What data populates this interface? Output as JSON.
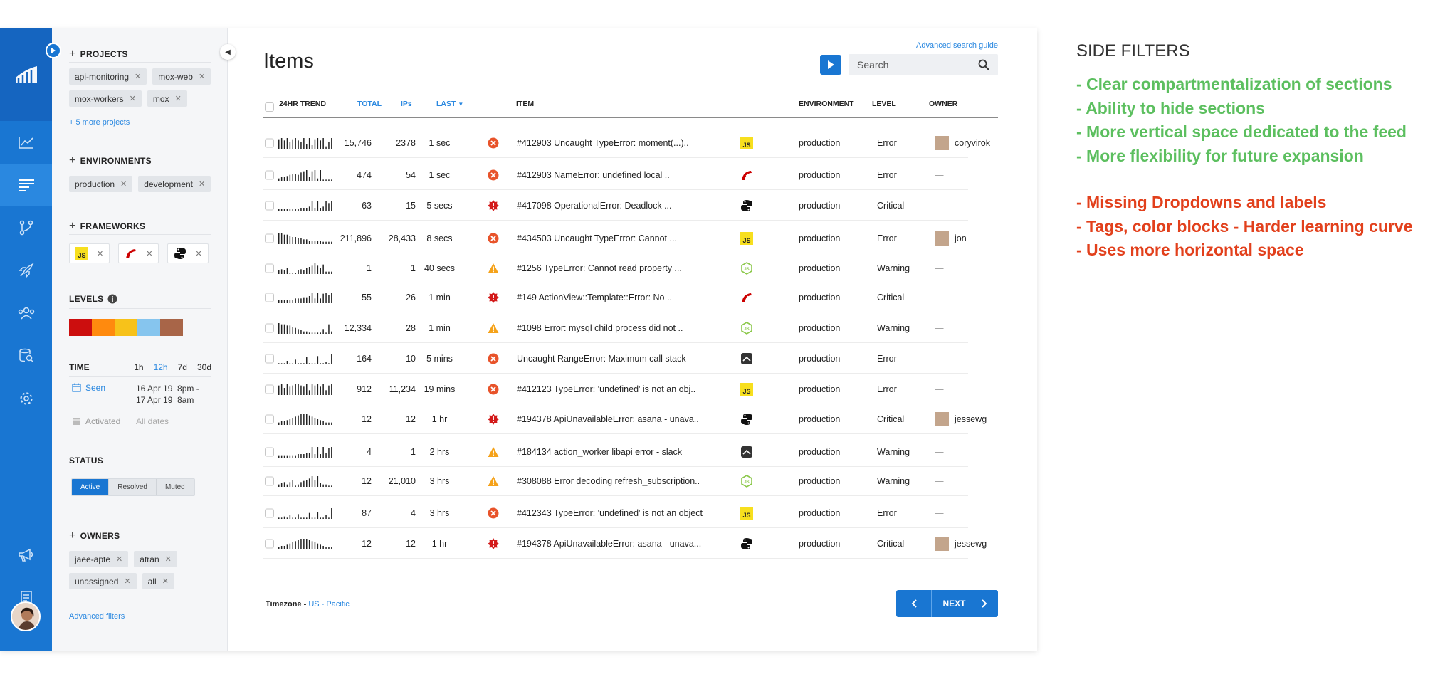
{
  "filters": {
    "projects": {
      "title": "PROJECTS",
      "tags": [
        "api-monitoring",
        "mox-web",
        "mox-workers",
        "mox"
      ],
      "more": "+ 5 more projects"
    },
    "environments": {
      "title": "ENVIRONMENTS",
      "tags": [
        "production",
        "development"
      ]
    },
    "frameworks": {
      "title": "FRAMEWORKS",
      "tags": [
        "javascript",
        "rails",
        "python"
      ]
    },
    "levels": {
      "title": "LEVELS",
      "colors": [
        "#cc0e0e",
        "#ff8a0e",
        "#f7c21a",
        "#86c5ee",
        "#a86548"
      ]
    },
    "time": {
      "title": "TIME",
      "options": [
        "1h",
        "12h",
        "7d",
        "30d"
      ],
      "selected": "12h",
      "seen_label": "Seen",
      "seen_value_1": "16 Apr 19  8pm -",
      "seen_value_2": "17 Apr 19  8am",
      "activated_label": "Activated",
      "activated_value": "All dates"
    },
    "status": {
      "title": "STATUS",
      "options": [
        "Active",
        "Resolved",
        "Muted"
      ],
      "selected": "Active"
    },
    "owners": {
      "title": "OWNERS",
      "tags": [
        "jaee-apte",
        "atran",
        "unassigned",
        "all"
      ]
    },
    "advanced": "Advanced filters"
  },
  "main": {
    "title": "Items",
    "advanced_search": "Advanced search guide",
    "search_placeholder": "Search",
    "columns": {
      "trend": "24HR TREND",
      "total": "TOTAL",
      "ips": "IPs",
      "last": "LAST",
      "item": "ITEM",
      "environment": "ENVIRONMENT",
      "level": "LEVEL",
      "owner": "OWNER"
    },
    "rows": [
      {
        "total": "15,746",
        "ips": "2378",
        "last": "1 sec",
        "status_icon": "error-icon",
        "item": "#412903 Uncaught TypeError: moment(...)..",
        "framework": "javascript",
        "env": "production",
        "level": "Error",
        "owner": "coryvirok",
        "trend": [
          8,
          9,
          7,
          9,
          6,
          8,
          9,
          7,
          6,
          9,
          4,
          9,
          3,
          8,
          9,
          7,
          9,
          2,
          6,
          9
        ]
      },
      {
        "total": "474",
        "ips": "54",
        "last": "1 sec",
        "status_icon": "error-icon",
        "item": "#412903 NameError: undefined local ..",
        "framework": "rails",
        "env": "production",
        "level": "Error",
        "owner": "",
        "trend": [
          2,
          3,
          3,
          4,
          5,
          6,
          6,
          5,
          7,
          8,
          9,
          3,
          8,
          9,
          2,
          9,
          1,
          1,
          1,
          1
        ]
      },
      {
        "total": "63",
        "ips": "15",
        "last": "5 secs",
        "status_icon": "critical-icon",
        "item": "#417098 OperationalError: Deadlock ...",
        "framework": "python",
        "env": "production",
        "level": "Critical",
        "owner": null,
        "trend": [
          2,
          2,
          2,
          2,
          2,
          2,
          2,
          2,
          3,
          3,
          3,
          4,
          9,
          3,
          9,
          3,
          4,
          9,
          7,
          9
        ]
      },
      {
        "total": "211,896",
        "ips": "28,433",
        "last": "8 secs",
        "status_icon": "error-icon",
        "item": "#434503 Uncaught TypeError: Cannot ...",
        "framework": "javascript",
        "env": "production",
        "level": "Error",
        "owner": "jon",
        "trend": [
          9,
          9,
          8,
          8,
          7,
          6,
          6,
          5,
          5,
          4,
          4,
          3,
          3,
          3,
          3,
          3,
          2,
          2,
          2,
          2
        ]
      },
      {
        "total": "1",
        "ips": "1",
        "last": "40 secs",
        "status_icon": "warning-icon",
        "item": "#1256 TypeError: Cannot read property ...",
        "framework": "nodejs",
        "env": "production",
        "level": "Warning",
        "owner": "",
        "trend": [
          3,
          4,
          3,
          5,
          1,
          1,
          1,
          3,
          4,
          3,
          5,
          6,
          7,
          9,
          7,
          5,
          8,
          2,
          2,
          2
        ]
      },
      {
        "total": "55",
        "ips": "26",
        "last": "1 min",
        "status_icon": "critical-icon",
        "item": "#149 ActionView::Template::Error: No ..",
        "framework": "rails",
        "env": "production",
        "level": "Critical",
        "owner": "",
        "trend": [
          3,
          3,
          3,
          3,
          3,
          3,
          4,
          4,
          4,
          5,
          5,
          6,
          9,
          4,
          9,
          4,
          8,
          9,
          7,
          9
        ]
      },
      {
        "total": "12,334",
        "ips": "28",
        "last": "1 min",
        "status_icon": "warning-icon",
        "item": "#1098 Error: mysql child process did not ..",
        "framework": "nodejs",
        "env": "production",
        "level": "Warning",
        "owner": "",
        "trend": [
          9,
          8,
          8,
          7,
          7,
          6,
          5,
          4,
          3,
          2,
          2,
          1,
          1,
          1,
          1,
          1,
          4,
          1,
          8,
          2
        ]
      },
      {
        "total": "164",
        "ips": "10",
        "last": "5 mins",
        "status_icon": "error-icon",
        "item": "Uncaught RangeError: Maximum call stack",
        "framework": "generic",
        "env": "production",
        "level": "Error",
        "owner": "",
        "trend": [
          1,
          1,
          1,
          3,
          1,
          1,
          4,
          1,
          1,
          1,
          6,
          1,
          1,
          1,
          7,
          1,
          1,
          2,
          1,
          9
        ]
      },
      {
        "total": "912",
        "ips": "11,234",
        "last": "19 mins",
        "status_icon": "error-icon",
        "item": "#412123 TypeError: 'undefined' is not an obj..",
        "framework": "javascript",
        "env": "production",
        "level": "Error",
        "owner": "",
        "trend": [
          8,
          9,
          6,
          9,
          7,
          8,
          9,
          9,
          8,
          7,
          9,
          4,
          9,
          8,
          9,
          7,
          9,
          4,
          8,
          9
        ]
      },
      {
        "total": "12",
        "ips": "12",
        "last": "1 hr",
        "status_icon": "critical-icon",
        "item": "#194378 ApiUnavailableError: asana - unava..",
        "framework": "python",
        "env": "production",
        "level": "Critical",
        "owner": "jessewg",
        "trend": [
          2,
          3,
          3,
          4,
          5,
          6,
          7,
          8,
          9,
          9,
          9,
          8,
          7,
          6,
          5,
          4,
          3,
          2,
          2,
          2
        ]
      },
      {
        "total": "4",
        "ips": "1",
        "last": "2 hrs",
        "status_icon": "warning-icon",
        "item": "#184134 action_worker libapi error - slack",
        "framework": "generic",
        "env": "production",
        "level": "Warning",
        "owner": "",
        "trend": [
          2,
          2,
          2,
          2,
          2,
          2,
          2,
          3,
          3,
          3,
          4,
          4,
          9,
          3,
          9,
          3,
          9,
          4,
          8,
          9
        ]
      },
      {
        "total": "12",
        "ips": "21,010",
        "last": "3 hrs",
        "status_icon": "warning-icon",
        "item": "#308088 Error decoding refresh_subscription..",
        "framework": "nodejs",
        "env": "production",
        "level": "Warning",
        "owner": "",
        "trend": [
          2,
          3,
          4,
          2,
          4,
          6,
          1,
          2,
          4,
          5,
          6,
          7,
          9,
          6,
          9,
          3,
          2,
          2,
          1,
          1
        ]
      },
      {
        "total": "87",
        "ips": "4",
        "last": "3 hrs",
        "status_icon": "error-icon",
        "item": "#412343 TypeError: 'undefined' is not an object",
        "framework": "javascript",
        "env": "production",
        "level": "Error",
        "owner": "",
        "trend": [
          1,
          1,
          2,
          1,
          3,
          1,
          1,
          4,
          1,
          1,
          1,
          5,
          1,
          1,
          6,
          1,
          1,
          3,
          1,
          9
        ]
      },
      {
        "total": "12",
        "ips": "12",
        "last": "1 hr",
        "status_icon": "critical-icon",
        "item": "#194378 ApiUnavailableError: asana - unava...",
        "framework": "python",
        "env": "production",
        "level": "Critical",
        "owner": "jessewg",
        "trend": [
          2,
          3,
          3,
          4,
          5,
          6,
          7,
          8,
          9,
          9,
          9,
          8,
          7,
          6,
          5,
          4,
          3,
          2,
          2,
          2
        ]
      }
    ],
    "timezone_label": "Timezone - ",
    "timezone_value": "US - Pacific",
    "next": "NEXT"
  },
  "notes": {
    "title": "SIDE FILTERS",
    "pros": [
      "- Clear compartmentalization of sections",
      "- Ability to hide sections",
      "- More vertical space dedicated to the feed",
      "- More flexibility for future expansion"
    ],
    "cons": [
      "- Missing Dropdowns and labels",
      "- Tags, color blocks - Harder learning curve",
      "- Uses more horizontal space"
    ]
  }
}
